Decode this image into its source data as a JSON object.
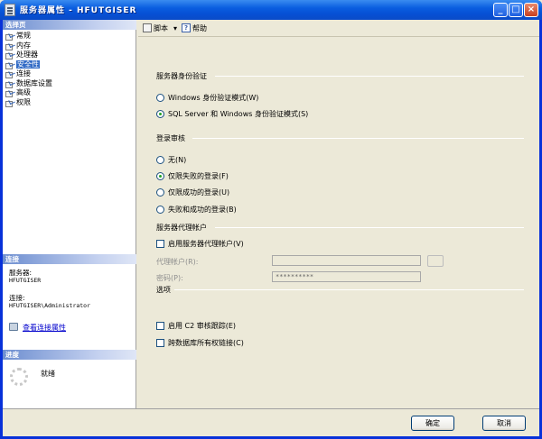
{
  "window": {
    "title": "服务器属性 - HFUTGISER"
  },
  "left_pane": {
    "select_page_header": "选择页",
    "nav_items": [
      {
        "label": "常规"
      },
      {
        "label": "内存"
      },
      {
        "label": "处理器"
      },
      {
        "label": "安全性",
        "selected": true
      },
      {
        "label": "连接"
      },
      {
        "label": "数据库设置"
      },
      {
        "label": "高级"
      },
      {
        "label": "权限"
      }
    ],
    "connection_header": "连接",
    "server_label": "服务器:",
    "server_value": "HFUTGISER",
    "connection_label": "连接:",
    "connection_value": "HFUTGISER\\Administrator",
    "view_connection_link": "查看连接属性",
    "progress_header": "进度",
    "progress_status": "就绪"
  },
  "toolbar": {
    "script_label": "脚本",
    "script_dropdown_glyph": "▾",
    "help_label": "帮助"
  },
  "content": {
    "auth_group_title": "服务器身份验证",
    "auth_options": [
      {
        "label": "Windows 身份验证模式(W)",
        "checked": false
      },
      {
        "label": "SQL Server 和 Windows 身份验证模式(S)",
        "checked": true
      }
    ],
    "audit_group_title": "登录审核",
    "audit_options": [
      {
        "label": "无(N)",
        "checked": false
      },
      {
        "label": "仅限失败的登录(F)",
        "checked": true
      },
      {
        "label": "仅限成功的登录(U)",
        "checked": false
      },
      {
        "label": "失败和成功的登录(B)",
        "checked": false
      }
    ],
    "proxy_group_title": "服务器代理帐户",
    "enable_proxy_label": "启用服务器代理帐户(V)",
    "proxy_account_label": "代理帐户(R):",
    "proxy_account_value": "",
    "password_label": "密码(P):",
    "password_value": "**********",
    "options_group_title": "选项",
    "c2_audit_label": "启用 C2 审核跟踪(E)",
    "cross_db_chaining_label": "跨数据库所有权链接(C)"
  },
  "footer": {
    "ok_label": "确定",
    "cancel_label": "取消"
  }
}
